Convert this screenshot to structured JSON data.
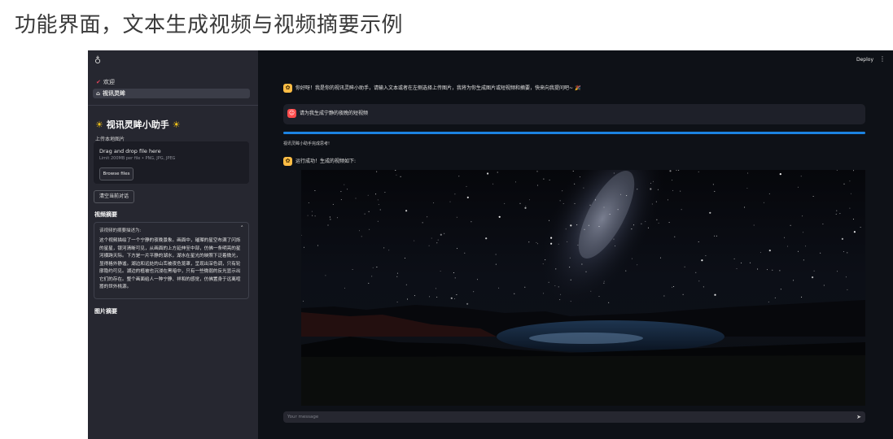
{
  "caption": "功能界面，文本生成视频与视频摘要示例",
  "sidebar": {
    "nav": [
      {
        "label": "欢迎",
        "icon": "heart-icon",
        "active": false
      },
      {
        "label": "视讯灵眸",
        "icon": "house-icon",
        "active": true
      }
    ],
    "title": "视讯灵眸小助手",
    "upload_label": "上传本地图片",
    "dropzone_title": "Drag and drop file here",
    "dropzone_limit": "Limit 200MB per file • PNG, JPG, JPEG",
    "browse_label": "Browse files",
    "clear_label": "清空当前对话",
    "video_summary_title": "视频摘要",
    "summary_header": "该视频的摘要描述为:",
    "summary_text": "这个视频描绘了一个宁静的夜晚景象。画面中，璀璨的星空布满了闪烁的星星，银河清晰可见，从画面的上方延伸至中部，仿佛一条明亮的星河横跨天际。下方是一片平静的湖水，湖水在星光的映照下泛着微光，显得格外静谧。湖边和远处的山峦被夜色笼罩，呈现出深色调，只有轮廓隐约可见。湖边的植被也沉浸在黑暗中，只有一些微弱的反光显示出它们的存在。整个画面给人一种宁静、祥和的感觉，仿佛置身于远离喧嚣的世外桃源。",
    "image_summary_title": "图片摘要"
  },
  "main": {
    "deploy_label": "Deploy",
    "greeting": "你好呀！我是你的视讯灵眸小助手，请输入文本或者在左侧选择上传图片，我将为你生成图片或短视频和摘要，快来向我提问吧~",
    "user_message": "请为我生成宁静的夜晚的短视频",
    "progress_text": "视讯灵眸小助手完成思考!",
    "progress": 1.0,
    "result_message": "运行成功！生成的视频如下:",
    "chat_placeholder": "Your message"
  },
  "colors": {
    "accent": "#1c83e1",
    "bot_avatar": "#ffbd45",
    "user_avatar": "#ff4b4b"
  }
}
